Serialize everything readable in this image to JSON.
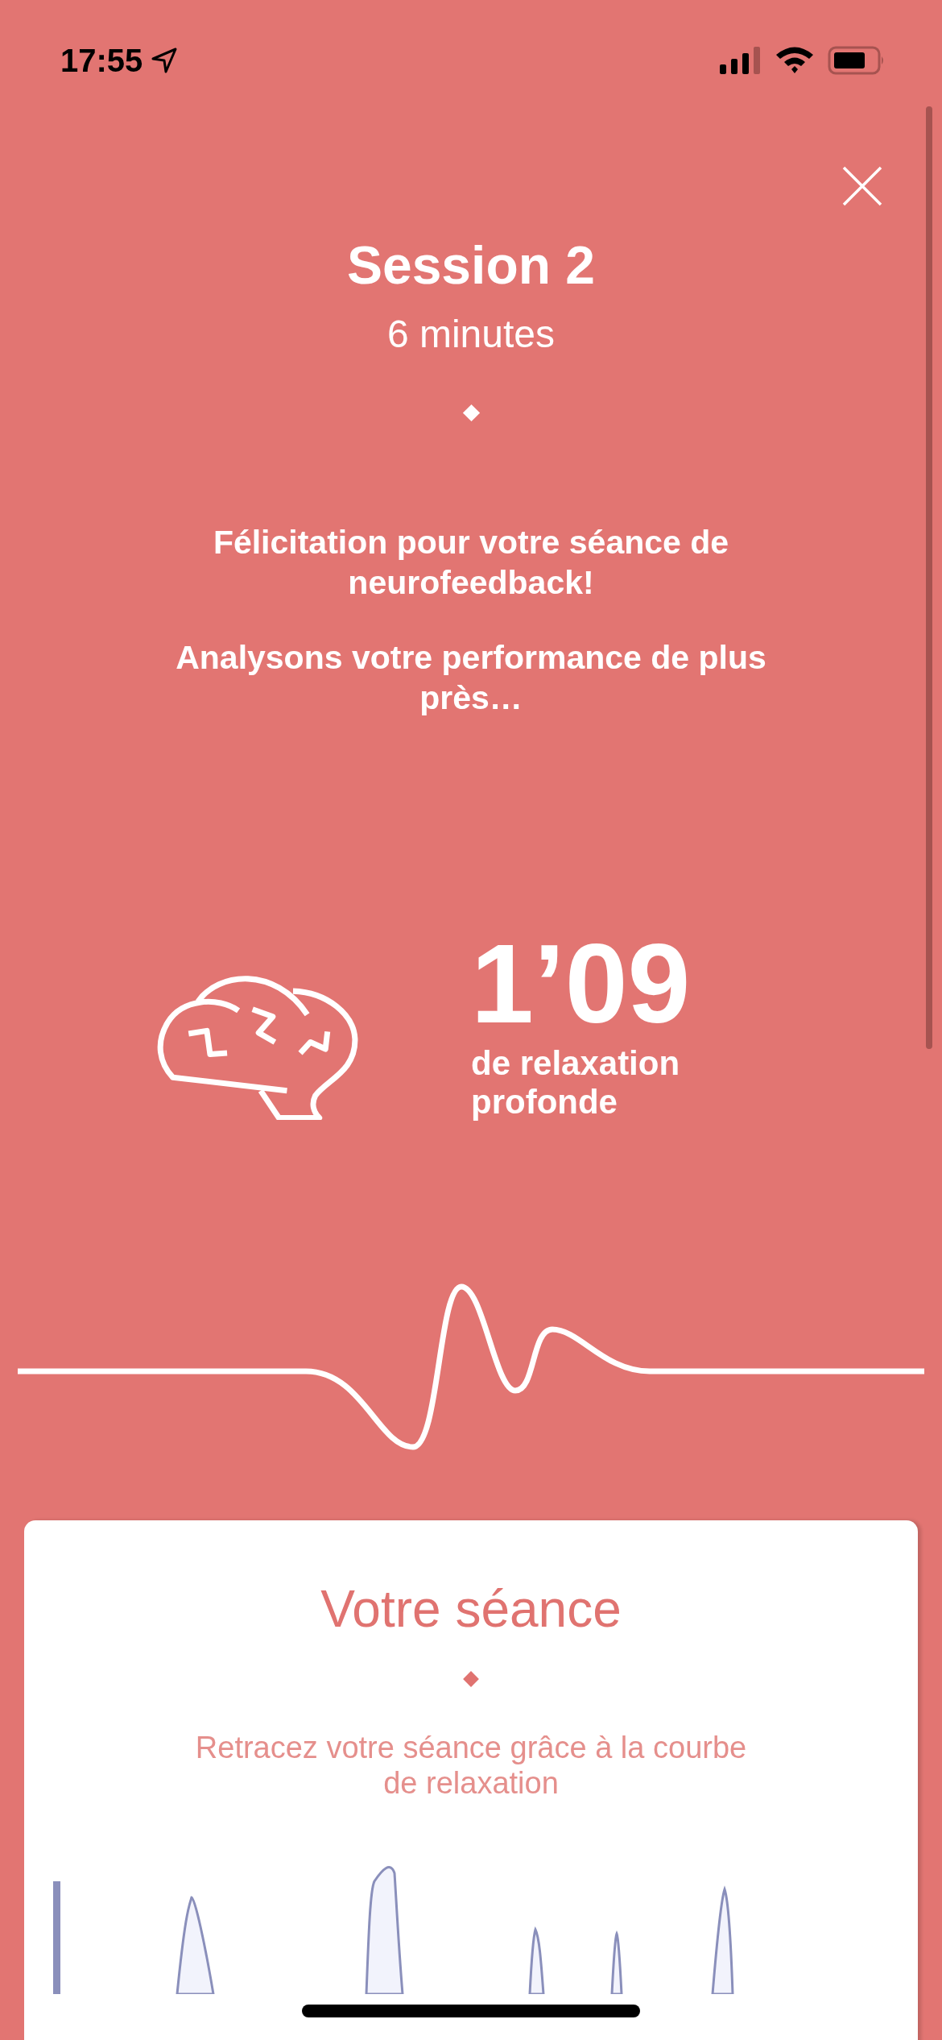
{
  "status_bar": {
    "time": "17:55"
  },
  "header": {
    "title": "Session 2",
    "subtitle": "6 minutes"
  },
  "messages": [
    "Félicitation pour votre séance de neurofeedback!",
    "Analysons votre performance de plus près…"
  ],
  "stat": {
    "value": "1’09",
    "label": "de relaxation profonde"
  },
  "card": {
    "title": "Votre séance",
    "description": "Retracez votre séance grâce à la courbe de relaxation"
  }
}
